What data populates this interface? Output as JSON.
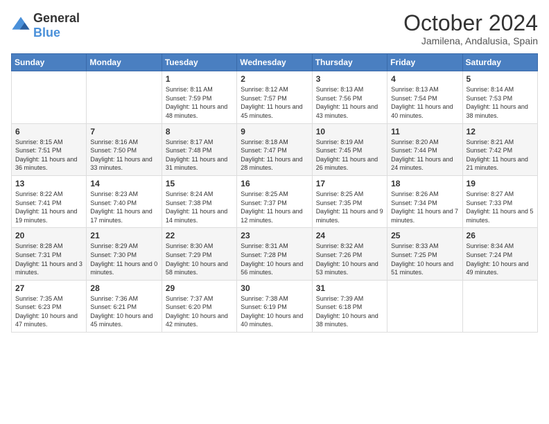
{
  "header": {
    "logo": {
      "general": "General",
      "blue": "Blue"
    },
    "title": "October 2024",
    "location": "Jamilena, Andalusia, Spain"
  },
  "calendar": {
    "days_of_week": [
      "Sunday",
      "Monday",
      "Tuesday",
      "Wednesday",
      "Thursday",
      "Friday",
      "Saturday"
    ],
    "weeks": [
      [
        {
          "day": "",
          "info": ""
        },
        {
          "day": "",
          "info": ""
        },
        {
          "day": "1",
          "info": "Sunrise: 8:11 AM\nSunset: 7:59 PM\nDaylight: 11 hours and 48 minutes."
        },
        {
          "day": "2",
          "info": "Sunrise: 8:12 AM\nSunset: 7:57 PM\nDaylight: 11 hours and 45 minutes."
        },
        {
          "day": "3",
          "info": "Sunrise: 8:13 AM\nSunset: 7:56 PM\nDaylight: 11 hours and 43 minutes."
        },
        {
          "day": "4",
          "info": "Sunrise: 8:13 AM\nSunset: 7:54 PM\nDaylight: 11 hours and 40 minutes."
        },
        {
          "day": "5",
          "info": "Sunrise: 8:14 AM\nSunset: 7:53 PM\nDaylight: 11 hours and 38 minutes."
        }
      ],
      [
        {
          "day": "6",
          "info": "Sunrise: 8:15 AM\nSunset: 7:51 PM\nDaylight: 11 hours and 36 minutes."
        },
        {
          "day": "7",
          "info": "Sunrise: 8:16 AM\nSunset: 7:50 PM\nDaylight: 11 hours and 33 minutes."
        },
        {
          "day": "8",
          "info": "Sunrise: 8:17 AM\nSunset: 7:48 PM\nDaylight: 11 hours and 31 minutes."
        },
        {
          "day": "9",
          "info": "Sunrise: 8:18 AM\nSunset: 7:47 PM\nDaylight: 11 hours and 28 minutes."
        },
        {
          "day": "10",
          "info": "Sunrise: 8:19 AM\nSunset: 7:45 PM\nDaylight: 11 hours and 26 minutes."
        },
        {
          "day": "11",
          "info": "Sunrise: 8:20 AM\nSunset: 7:44 PM\nDaylight: 11 hours and 24 minutes."
        },
        {
          "day": "12",
          "info": "Sunrise: 8:21 AM\nSunset: 7:42 PM\nDaylight: 11 hours and 21 minutes."
        }
      ],
      [
        {
          "day": "13",
          "info": "Sunrise: 8:22 AM\nSunset: 7:41 PM\nDaylight: 11 hours and 19 minutes."
        },
        {
          "day": "14",
          "info": "Sunrise: 8:23 AM\nSunset: 7:40 PM\nDaylight: 11 hours and 17 minutes."
        },
        {
          "day": "15",
          "info": "Sunrise: 8:24 AM\nSunset: 7:38 PM\nDaylight: 11 hours and 14 minutes."
        },
        {
          "day": "16",
          "info": "Sunrise: 8:25 AM\nSunset: 7:37 PM\nDaylight: 11 hours and 12 minutes."
        },
        {
          "day": "17",
          "info": "Sunrise: 8:25 AM\nSunset: 7:35 PM\nDaylight: 11 hours and 9 minutes."
        },
        {
          "day": "18",
          "info": "Sunrise: 8:26 AM\nSunset: 7:34 PM\nDaylight: 11 hours and 7 minutes."
        },
        {
          "day": "19",
          "info": "Sunrise: 8:27 AM\nSunset: 7:33 PM\nDaylight: 11 hours and 5 minutes."
        }
      ],
      [
        {
          "day": "20",
          "info": "Sunrise: 8:28 AM\nSunset: 7:31 PM\nDaylight: 11 hours and 3 minutes."
        },
        {
          "day": "21",
          "info": "Sunrise: 8:29 AM\nSunset: 7:30 PM\nDaylight: 11 hours and 0 minutes."
        },
        {
          "day": "22",
          "info": "Sunrise: 8:30 AM\nSunset: 7:29 PM\nDaylight: 10 hours and 58 minutes."
        },
        {
          "day": "23",
          "info": "Sunrise: 8:31 AM\nSunset: 7:28 PM\nDaylight: 10 hours and 56 minutes."
        },
        {
          "day": "24",
          "info": "Sunrise: 8:32 AM\nSunset: 7:26 PM\nDaylight: 10 hours and 53 minutes."
        },
        {
          "day": "25",
          "info": "Sunrise: 8:33 AM\nSunset: 7:25 PM\nDaylight: 10 hours and 51 minutes."
        },
        {
          "day": "26",
          "info": "Sunrise: 8:34 AM\nSunset: 7:24 PM\nDaylight: 10 hours and 49 minutes."
        }
      ],
      [
        {
          "day": "27",
          "info": "Sunrise: 7:35 AM\nSunset: 6:23 PM\nDaylight: 10 hours and 47 minutes."
        },
        {
          "day": "28",
          "info": "Sunrise: 7:36 AM\nSunset: 6:21 PM\nDaylight: 10 hours and 45 minutes."
        },
        {
          "day": "29",
          "info": "Sunrise: 7:37 AM\nSunset: 6:20 PM\nDaylight: 10 hours and 42 minutes."
        },
        {
          "day": "30",
          "info": "Sunrise: 7:38 AM\nSunset: 6:19 PM\nDaylight: 10 hours and 40 minutes."
        },
        {
          "day": "31",
          "info": "Sunrise: 7:39 AM\nSunset: 6:18 PM\nDaylight: 10 hours and 38 minutes."
        },
        {
          "day": "",
          "info": ""
        },
        {
          "day": "",
          "info": ""
        }
      ]
    ]
  }
}
